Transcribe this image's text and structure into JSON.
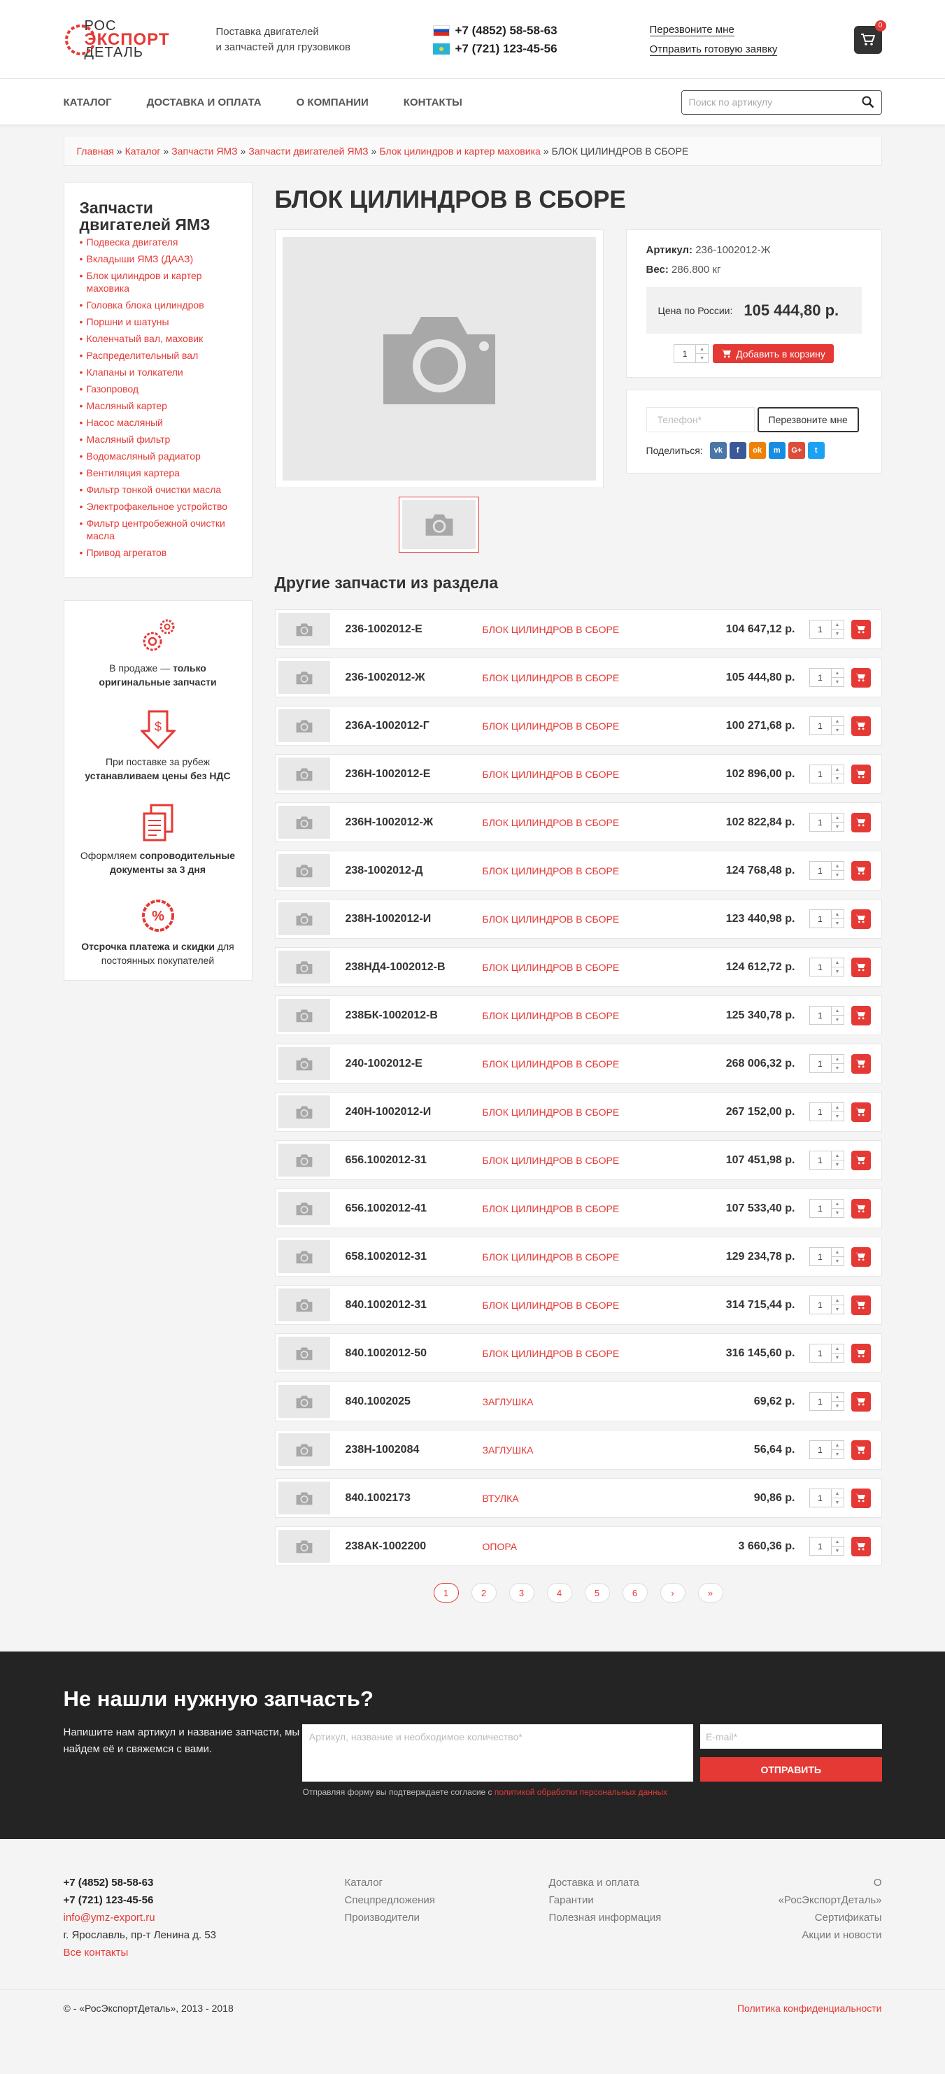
{
  "logo": {
    "line1": "РОС",
    "line2": "ЭКСПОРТ",
    "line3": "ДЕТАЛЬ"
  },
  "header": {
    "tagline_1": "Поставка двигателей",
    "tagline_2": "и запчастей для грузовиков",
    "phone_ru": "+7 (4852) 58-58-63",
    "phone_kz": "+7 (721) 123-45-56",
    "callback_link": "Перезвоните мне",
    "send_request_link": "Отправить готовую заявку",
    "cart_count": "0"
  },
  "nav": {
    "items": [
      "Каталог",
      "Доставка и оплата",
      "О компании",
      "Контакты"
    ],
    "search_placeholder": "Поиск по артикулу"
  },
  "breadcrumb": {
    "items": [
      "Главная",
      "Каталог",
      "Запчасти ЯМЗ",
      "Запчасти двигателей ЯМЗ",
      "Блок цилиндров и картер маховика"
    ],
    "current": "БЛОК ЦИЛИНДРОВ В СБОРЕ"
  },
  "sidebar": {
    "title": "Запчасти двигателей ЯМЗ",
    "items": [
      "Подвеска двигателя",
      "Вкладыши ЯМЗ (ДААЗ)",
      "Блок цилиндров и картер маховика",
      "Головка блока цилиндров",
      "Поршни и шатуны",
      "Коленчатый вал, маховик",
      "Распределительный вал",
      "Клапаны и толкатели",
      "Газопровод",
      "Масляный картер",
      "Насос масляный",
      "Масляный фильтр",
      "Водомасляный радиатор",
      "Вентиляция картера",
      "Фильтр тонкой очистки масла",
      "Электрофакельное устройство",
      "Фильтр центробежной очистки масла",
      "Привод агрегатов"
    ]
  },
  "features": [
    {
      "pre": "В продаже — ",
      "bold": "только оригинальные запчасти",
      "post": ""
    },
    {
      "pre": "При поставке за рубеж ",
      "bold": "устанавливаем цены без НДС",
      "post": ""
    },
    {
      "pre": "Оформляем ",
      "bold": "сопроводительные документы за 3 дня",
      "post": ""
    },
    {
      "pre": "",
      "bold": "Отсрочка платежа и скидки",
      "post": " для постоянных покупателей"
    }
  ],
  "product": {
    "title": "БЛОК ЦИЛИНДРОВ В СБОРЕ",
    "article_label": "Артикул:",
    "article": "236-1002012-Ж",
    "weight_label": "Вес:",
    "weight": "286.800 кг",
    "price_label": "Цена по России:",
    "price": "105 444,80 р.",
    "qty": "1",
    "add_to_cart": "Добавить в корзину",
    "phone_placeholder": "Телефон*",
    "callback_button": "Перезвоните мне",
    "share_label": "Поделиться:"
  },
  "share_icons": [
    {
      "label": "vk",
      "color": "#4a76a8"
    },
    {
      "label": "f",
      "color": "#3b5998"
    },
    {
      "label": "ok",
      "color": "#ee8208"
    },
    {
      "label": "m",
      "color": "#168de2"
    },
    {
      "label": "G+",
      "color": "#dd4b39"
    },
    {
      "label": "t",
      "color": "#1da1f2"
    }
  ],
  "other_parts": {
    "title": "Другие запчасти из раздела",
    "rows": [
      {
        "article": "236-1002012-Е",
        "name": "БЛОК ЦИЛИНДРОВ В СБОРЕ",
        "price": "104 647,12 р.",
        "qty": "1"
      },
      {
        "article": "236-1002012-Ж",
        "name": "БЛОК ЦИЛИНДРОВ В СБОРЕ",
        "price": "105 444,80 р.",
        "qty": "1"
      },
      {
        "article": "236А-1002012-Г",
        "name": "БЛОК ЦИЛИНДРОВ В СБОРЕ",
        "price": "100 271,68 р.",
        "qty": "1"
      },
      {
        "article": "236Н-1002012-Е",
        "name": "БЛОК ЦИЛИНДРОВ В СБОРЕ",
        "price": "102 896,00 р.",
        "qty": "1"
      },
      {
        "article": "236Н-1002012-Ж",
        "name": "БЛОК ЦИЛИНДРОВ В СБОРЕ",
        "price": "102 822,84 р.",
        "qty": "1"
      },
      {
        "article": "238-1002012-Д",
        "name": "БЛОК ЦИЛИНДРОВ В СБОРЕ",
        "price": "124 768,48 р.",
        "qty": "1"
      },
      {
        "article": "238Н-1002012-И",
        "name": "БЛОК ЦИЛИНДРОВ В СБОРЕ",
        "price": "123 440,98 р.",
        "qty": "1"
      },
      {
        "article": "238НД4-1002012-В",
        "name": "БЛОК ЦИЛИНДРОВ В СБОРЕ",
        "price": "124 612,72 р.",
        "qty": "1"
      },
      {
        "article": "238БК-1002012-В",
        "name": "БЛОК ЦИЛИНДРОВ В СБОРЕ",
        "price": "125 340,78 р.",
        "qty": "1"
      },
      {
        "article": "240-1002012-Е",
        "name": "БЛОК ЦИЛИНДРОВ В СБОРЕ",
        "price": "268 006,32 р.",
        "qty": "1"
      },
      {
        "article": "240Н-1002012-И",
        "name": "БЛОК ЦИЛИНДРОВ В СБОРЕ",
        "price": "267 152,00 р.",
        "qty": "1"
      },
      {
        "article": "656.1002012-31",
        "name": "БЛОК ЦИЛИНДРОВ В СБОРЕ",
        "price": "107 451,98 р.",
        "qty": "1"
      },
      {
        "article": "656.1002012-41",
        "name": "БЛОК ЦИЛИНДРОВ В СБОРЕ",
        "price": "107 533,40 р.",
        "qty": "1"
      },
      {
        "article": "658.1002012-31",
        "name": "БЛОК ЦИЛИНДРОВ В СБОРЕ",
        "price": "129 234,78 р.",
        "qty": "1"
      },
      {
        "article": "840.1002012-31",
        "name": "БЛОК ЦИЛИНДРОВ В СБОРЕ",
        "price": "314 715,44 р.",
        "qty": "1"
      },
      {
        "article": "840.1002012-50",
        "name": "БЛОК ЦИЛИНДРОВ В СБОРЕ",
        "price": "316 145,60 р.",
        "qty": "1"
      },
      {
        "article": "840.1002025",
        "name": "ЗАГЛУШКА",
        "price": "69,62 р.",
        "qty": "1"
      },
      {
        "article": "238Н-1002084",
        "name": "ЗАГЛУШКА",
        "price": "56,64 р.",
        "qty": "1"
      },
      {
        "article": "840.1002173",
        "name": "ВТУЛКА",
        "price": "90,86 р.",
        "qty": "1"
      },
      {
        "article": "238АК-1002200",
        "name": "ОПОРА",
        "price": "3 660,36 р.",
        "qty": "1"
      }
    ]
  },
  "pagination": {
    "pages": [
      "1",
      "2",
      "3",
      "4",
      "5",
      "6",
      "›",
      "»"
    ],
    "active": "1"
  },
  "request_form": {
    "title": "Не нашли нужную запчасть?",
    "desc": "Напишите нам артикул и название запчасти, мы найдем её и свяжемся с вами.",
    "textarea_placeholder": "Артикул, название и необходимое количество*",
    "email_placeholder": "E-mail*",
    "submit": "Отправить",
    "consent_text": "Отправляя форму вы подтверждаете согласие с ",
    "consent_link": "политикой обработки персональных данных"
  },
  "footer": {
    "phone_ru": "+7 (4852) 58-58-63",
    "phone_kz": "+7 (721) 123-45-56",
    "email": "info@ymz-export.ru",
    "address": "г. Ярославль, пр-т Ленина д. 53",
    "all_contacts": "Все контакты",
    "col2": [
      "Каталог",
      "Спецпредложения",
      "Производители"
    ],
    "col3": [
      "Доставка и оплата",
      "Гарантии",
      "Полезная информация"
    ],
    "col4": [
      "О «РосЭкспортДеталь»",
      "Сертификаты",
      "Акции и новости"
    ],
    "copyright": "© - «РосЭкспортДеталь», 2013 - 2018",
    "privacy": "Политика конфиденциальности"
  },
  "colors": {
    "accent": "#e53935",
    "dark": "#242424",
    "bg": "#f4f4f4"
  }
}
